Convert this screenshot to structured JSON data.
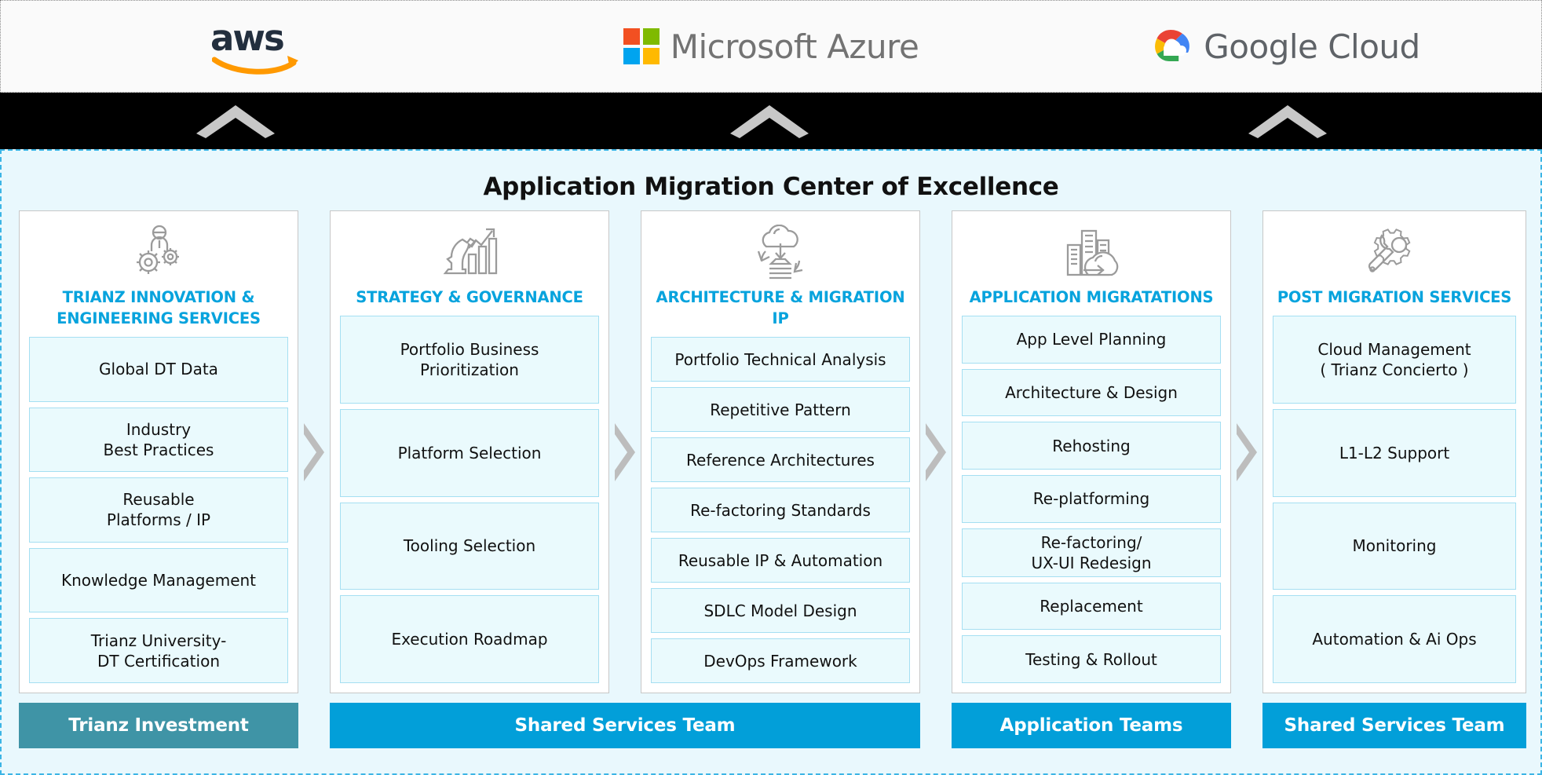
{
  "cloud_providers": [
    {
      "name": "aws-logo",
      "label": "aws"
    },
    {
      "name": "microsoft-azure-logo",
      "label": "Microsoft Azure",
      "word1": "Microsoft",
      "word2": "Azure"
    },
    {
      "name": "google-cloud-logo",
      "label": "Google Cloud",
      "word1": "Google",
      "word2": "Cloud"
    }
  ],
  "panel": {
    "title": "Application Migration Center of Excellence",
    "accent_color": "#07a3dd",
    "panel_bg": "#e9f8fd",
    "panel_border": "#3cb5e5",
    "item_bg": "#eafafd",
    "item_border": "#a5dff2"
  },
  "columns": [
    {
      "id": "trianz-innovation-engineering-services",
      "icon": "person-gears-icon",
      "title": "TRIANZ INNOVATION &\nENGINEERING SERVICES",
      "items": [
        "Global DT Data",
        "Industry\nBest Practices",
        "Reusable\nPlatforms / IP",
        "Knowledge Management",
        "Trianz University-\nDT Certification"
      ]
    },
    {
      "id": "strategy-governance",
      "icon": "chess-knight-bar-chart-icon",
      "title": "STRATEGY &\nGOVERNANCE",
      "items": [
        "Portfolio Business\nPrioritization",
        "Platform Selection",
        "Tooling Selection",
        "Execution Roadmap"
      ]
    },
    {
      "id": "architecture-migration-ip",
      "icon": "cloud-download-stack-icon",
      "title": "ARCHITECTURE &\nMIGRATION IP",
      "items": [
        "Portfolio Technical Analysis",
        "Repetitive Pattern",
        "Reference Architectures",
        "Re-factoring Standards",
        "Reusable IP & Automation",
        "SDLC Model Design",
        "DevOps Framework"
      ]
    },
    {
      "id": "application-migratations",
      "icon": "buildings-to-cloud-icon",
      "title": "APPLICATION\nMIGRATATIONS",
      "items": [
        "App Level Planning",
        "Architecture & Design",
        "Rehosting",
        "Re-platforming",
        "Re-factoring/\nUX-UI Redesign",
        "Replacement",
        "Testing & Rollout"
      ]
    },
    {
      "id": "post-migration-services",
      "icon": "wrench-gear-icon",
      "title": "POST MIGRATION\nSERVICES",
      "items": [
        "Cloud Management\n( Trianz Concierto )",
        "L1-L2 Support",
        "Monitoring",
        "Automation & Ai Ops"
      ]
    }
  ],
  "team_bars": [
    {
      "label": "Trianz Investment",
      "color": "#3f94a6"
    },
    {
      "label": "Shared Services Team",
      "color": "#029fd9"
    },
    {
      "label": "Application Teams",
      "color": "#029fd9"
    },
    {
      "label": "Shared Services Team",
      "color": "#029fd9"
    }
  ]
}
